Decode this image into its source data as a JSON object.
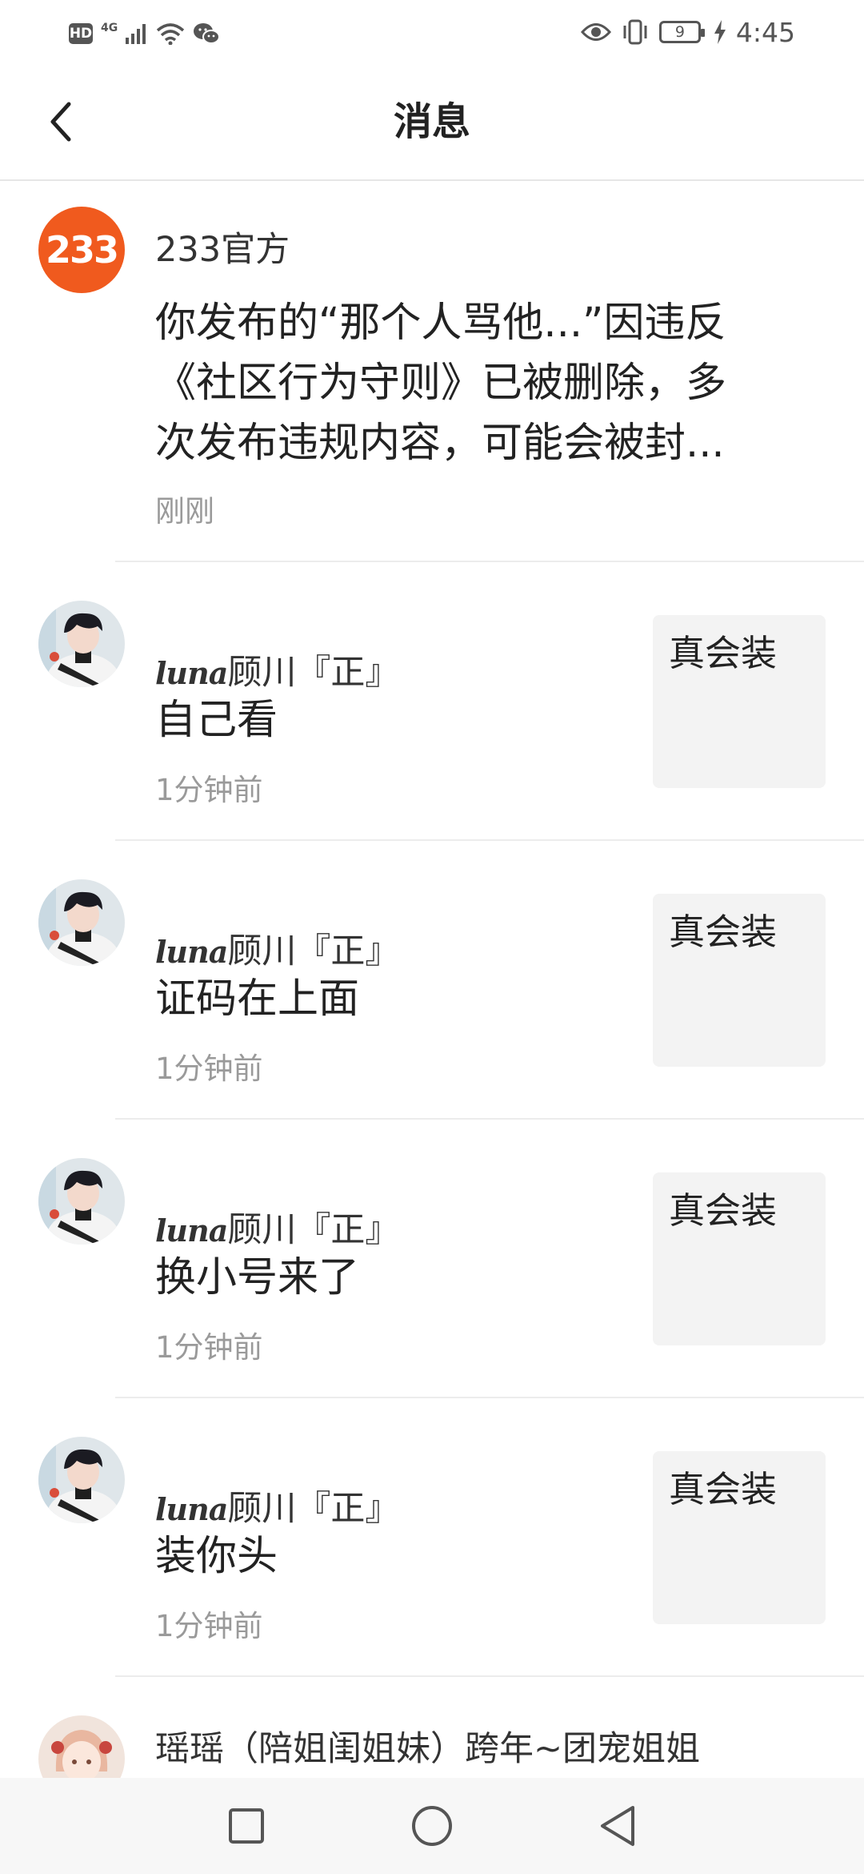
{
  "status_bar": {
    "hd": "HD",
    "network": "4G",
    "battery": "9",
    "time": "4:45"
  },
  "header": {
    "title": "消息"
  },
  "messages": [
    {
      "sender": "233官方",
      "content_lines": [
        "你发布的“那个人骂他...”因违反",
        "《社区行为守则》已被删除，多",
        "次发布违规内容，可能会被封..."
      ],
      "time": "刚刚",
      "avatar_text": "233"
    },
    {
      "sender_script": "luna",
      "sender": "顾川『正』",
      "content": "自己看",
      "time": "1分钟前",
      "quote": "真会装"
    },
    {
      "sender_script": "luna",
      "sender": "顾川『正』",
      "content": "证码在上面",
      "time": "1分钟前",
      "quote": "真会装"
    },
    {
      "sender_script": "luna",
      "sender": "顾川『正』",
      "content": "换小号来了",
      "time": "1分钟前",
      "quote": "真会装"
    },
    {
      "sender_script": "luna",
      "sender": "顾川『正』",
      "content": "装你头",
      "time": "1分钟前",
      "quote": "真会装"
    },
    {
      "sender": "瑶瑶（陪姐闺姐妹）跨年~团宠姐姐"
    }
  ],
  "colors": {
    "brand_orange": "#f05a1e",
    "divider": "#ececec",
    "quote_bg": "#f3f3f3"
  },
  "icons": {
    "back": "chevron-left-icon",
    "nav_recent": "square-icon",
    "nav_home": "circle-icon",
    "nav_back": "triangle-left-icon"
  }
}
